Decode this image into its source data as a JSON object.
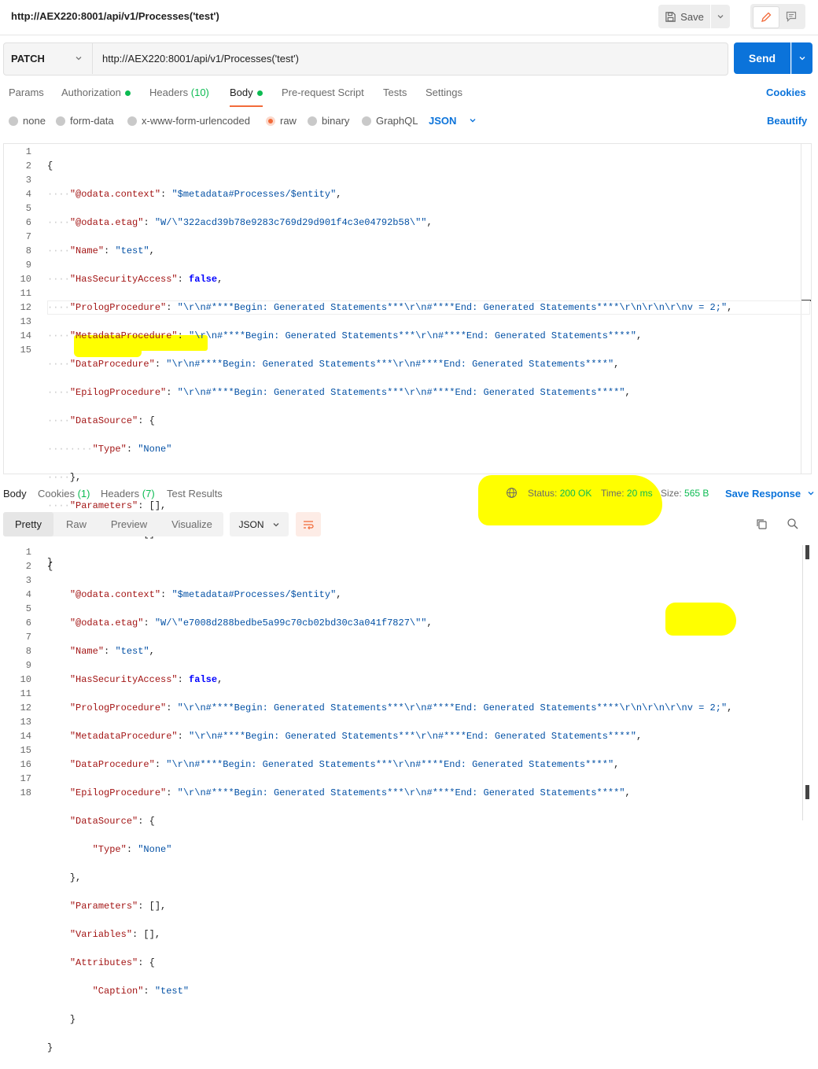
{
  "header": {
    "title": "http://AEX220:8001/api/v1/Processes('test')",
    "save_label": "Save"
  },
  "request": {
    "method": "PATCH",
    "url": "http://AEX220:8001/api/v1/Processes('test')",
    "send_label": "Send"
  },
  "tabs": {
    "params": "Params",
    "authorization": "Authorization",
    "headers": "Headers",
    "headers_count": "(10)",
    "body": "Body",
    "prerequest": "Pre-request Script",
    "tests": "Tests",
    "settings": "Settings",
    "cookies": "Cookies"
  },
  "body_types": {
    "none": "none",
    "form_data": "form-data",
    "urlencoded": "x-www-form-urlencoded",
    "raw": "raw",
    "binary": "binary",
    "graphql": "GraphQL",
    "format": "JSON",
    "beautify": "Beautify"
  },
  "request_body": {
    "line_numbers": [
      "1",
      "2",
      "3",
      "4",
      "5",
      "6",
      "7",
      "8",
      "9",
      "10",
      "11",
      "12",
      "13",
      "14",
      "15"
    ],
    "odata_context_key": "\"@odata.context\"",
    "odata_context_val": "\"$metadata#Processes/$entity\"",
    "odata_etag_key": "\"@odata.etag\"",
    "odata_etag_val": "\"W/\\\"322acd39b78e9283c769d29d901f4c3e04792b58\\\"\"",
    "name_key": "\"Name\"",
    "name_val": "\"test\"",
    "security_key": "\"HasSecurityAccess\"",
    "security_val": "false",
    "prolog_key": "\"PrologProcedure\"",
    "prolog_val": "\"\\r\\n#****Begin: Generated Statements***\\r\\n#****End: Generated Statements****\\r\\n\\r\\n\\r\\nv = 2;\"",
    "metadata_key": "\"MetadataProcedure\"",
    "metadata_val": "\"\\r\\n#****Begin: Generated Statements***\\r\\n#****End: Generated Statements****\"",
    "data_key": "\"DataProcedure\"",
    "data_val": "\"\\r\\n#****Begin: Generated Statements***\\r\\n#****End: Generated Statements****\"",
    "epilog_key": "\"EpilogProcedure\"",
    "epilog_val": "\"\\r\\n#****Begin: Generated Statements***\\r\\n#****End: Generated Statements****\"",
    "datasource_key": "\"DataSource\"",
    "type_key": "\"Type\"",
    "type_val": "\"None\"",
    "parameters_key": "\"Parameters\"",
    "variables_key": "\"Variables\""
  },
  "response": {
    "tabs": {
      "body": "Body",
      "cookies": "Cookies",
      "cookies_count": "(1)",
      "headers": "Headers",
      "headers_count": "(7)",
      "test_results": "Test Results"
    },
    "status_label": "Status:",
    "status_value": "200 OK",
    "time_label": "Time:",
    "time_value": "20 ms",
    "size_label": "Size:",
    "size_value": "565 B",
    "save_response": "Save Response",
    "views": {
      "pretty": "Pretty",
      "raw": "Raw",
      "preview": "Preview",
      "visualize": "Visualize"
    },
    "format": "JSON"
  },
  "response_body": {
    "line_numbers": [
      "1",
      "2",
      "3",
      "4",
      "5",
      "6",
      "7",
      "8",
      "9",
      "10",
      "11",
      "12",
      "13",
      "14",
      "15",
      "16",
      "17",
      "18"
    ],
    "odata_context_key": "\"@odata.context\"",
    "odata_context_val": "\"$metadata#Processes/$entity\"",
    "odata_etag_key": "\"@odata.etag\"",
    "odata_etag_val": "\"W/\\\"e7008d288bedbe5a99c70cb02bd30c3a041f7827\\\"\"",
    "name_key": "\"Name\"",
    "name_val": "\"test\"",
    "security_key": "\"HasSecurityAccess\"",
    "security_val": "false",
    "prolog_key": "\"PrologProcedure\"",
    "prolog_val": "\"\\r\\n#****Begin: Generated Statements***\\r\\n#****End: Generated Statements****\\r\\n\\r\\n\\r\\nv = 2;\"",
    "metadata_key": "\"MetadataProcedure\"",
    "metadata_val": "\"\\r\\n#****Begin: Generated Statements***\\r\\n#****End: Generated Statements****\"",
    "data_key": "\"DataProcedure\"",
    "data_val": "\"\\r\\n#****Begin: Generated Statements***\\r\\n#****End: Generated Statements****\"",
    "epilog_key": "\"EpilogProcedure\"",
    "epilog_val": "\"\\r\\n#****Begin: Generated Statements***\\r\\n#****End: Generated Statements****\"",
    "datasource_key": "\"DataSource\"",
    "type_key": "\"Type\"",
    "type_val": "\"None\"",
    "parameters_key": "\"Parameters\"",
    "variables_key": "\"Variables\"",
    "attributes_key": "\"Attributes\"",
    "caption_key": "\"Caption\"",
    "caption_val": "\"test\""
  },
  "colors": {
    "accent": "#0b73da",
    "tab_underline": "#f26b3a",
    "status_ok": "#0cbb52",
    "highlighter": "#ffff00"
  }
}
